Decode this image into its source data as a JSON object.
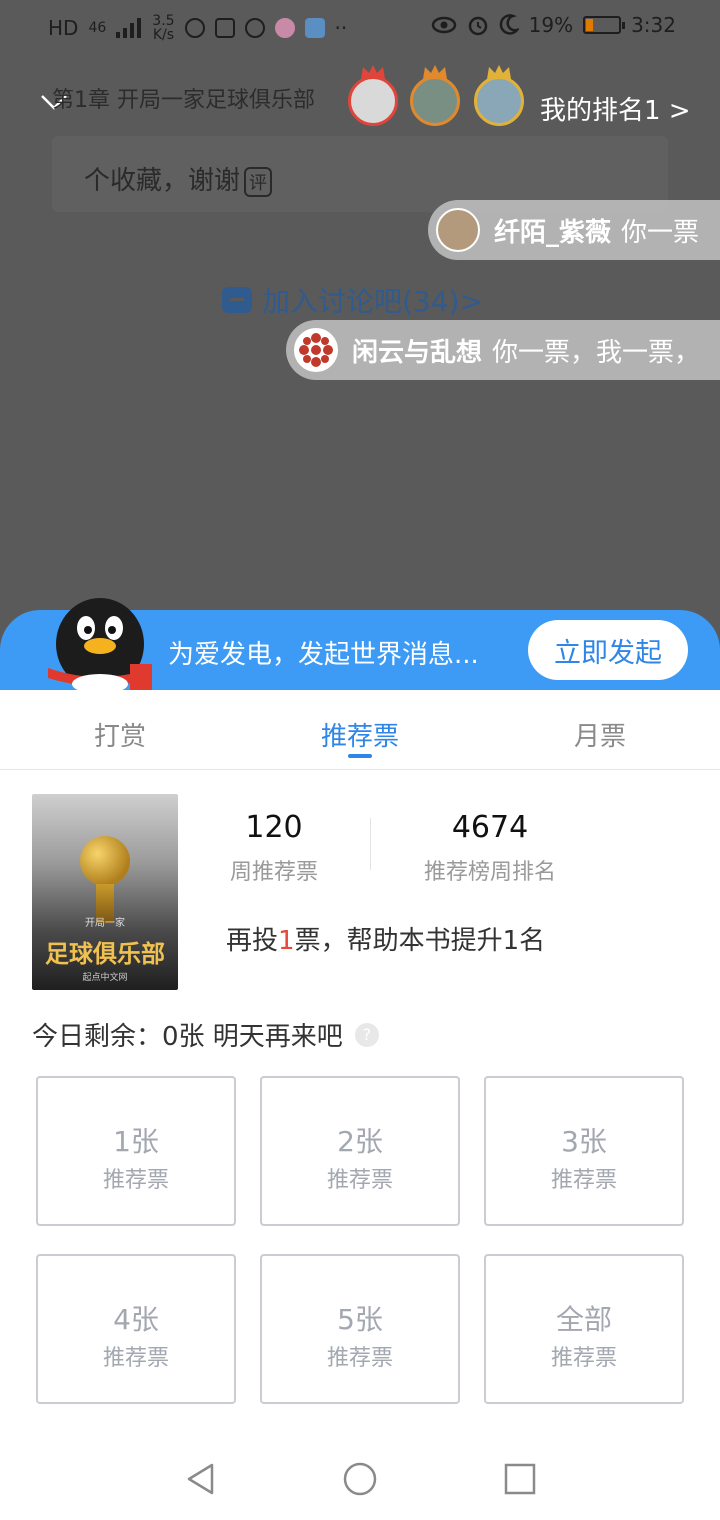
{
  "status_bar": {
    "hd": "HD",
    "network": "46",
    "speed_value": "3.5",
    "speed_unit": "K/s",
    "battery": "19%",
    "time": "3:32",
    "icons": [
      "k-icon",
      "doc-icon",
      "qq-icon",
      "lola-icon",
      "app-icon",
      "more-icon",
      "eye-icon",
      "alarm-icon",
      "moon-icon",
      "battery-icon"
    ]
  },
  "header": {
    "chapter_title": "第1章 开局一家足球俱乐部",
    "my_rank": "我的排名1 >"
  },
  "comment": {
    "text": "个收藏，谢谢",
    "tag": "评"
  },
  "danmaku": [
    {
      "user": "纤陌_紫薇",
      "text": "你一票"
    },
    {
      "user": "闲云与乱想",
      "text": "你一票，我一票，"
    }
  ],
  "discuss": {
    "label": "加入讨论吧(34)>"
  },
  "banner": {
    "text": "为爱发电，发起世界消息...",
    "button": "立即发起"
  },
  "tabs": [
    {
      "label": "打赏"
    },
    {
      "label": "推荐票"
    },
    {
      "label": "月票"
    }
  ],
  "book": {
    "cover_sub": "开局一家",
    "cover_title": "足球俱乐部",
    "cover_pub": "起点中文网"
  },
  "stats": {
    "weekly_votes": "120",
    "weekly_votes_label": "周推荐票",
    "rank": "4674",
    "rank_label": "推荐榜周排名"
  },
  "boost": {
    "prefix": "再投",
    "count": "1",
    "suffix": "票，帮助本书提升1名"
  },
  "remaining": {
    "text": "今日剩余：0张 明天再来吧",
    "help": "?"
  },
  "tickets": [
    {
      "amount": "1张",
      "label": "推荐票"
    },
    {
      "amount": "2张",
      "label": "推荐票"
    },
    {
      "amount": "3张",
      "label": "推荐票"
    },
    {
      "amount": "4张",
      "label": "推荐票"
    },
    {
      "amount": "5张",
      "label": "推荐票"
    },
    {
      "amount": "全部",
      "label": "推荐票"
    }
  ]
}
